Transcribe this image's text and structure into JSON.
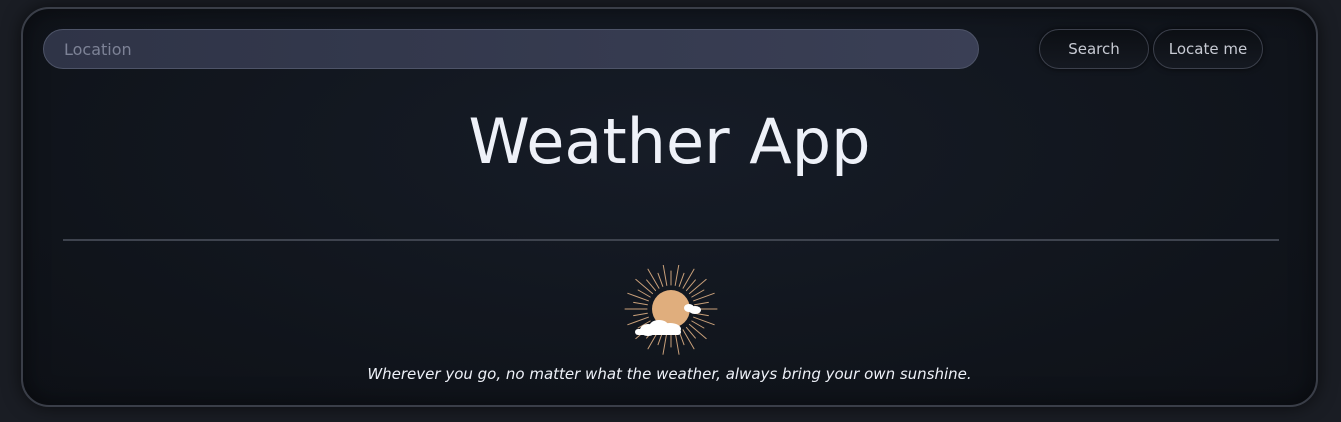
{
  "search": {
    "placeholder": "Location",
    "value": ""
  },
  "buttons": {
    "search_label": "Search",
    "locate_label": "Locate me"
  },
  "header": {
    "title": "Weather App"
  },
  "hero": {
    "icon": "sun-behind-cloud-icon",
    "quote": "Wherever you go, no matter what the weather, always bring your own sunshine."
  },
  "colors": {
    "background": "#1a1d24",
    "card": "#10141b",
    "input_fill": "#363b50",
    "sun": "#e0ae7d",
    "sun_rays": "#c9a07a",
    "cloud": "#ffffff",
    "text": "#eef1f8"
  }
}
